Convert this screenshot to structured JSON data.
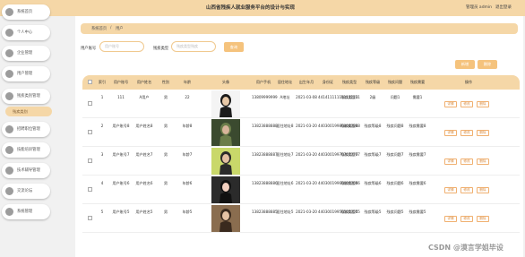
{
  "header": {
    "title": "山西省残疾人就业服务平台的设计与实现",
    "user": "管理员 admin",
    "exit": "退出登录"
  },
  "sidebar": {
    "items": [
      {
        "label": "系统首页"
      },
      {
        "label": "个人中心"
      },
      {
        "label": "企业管理"
      },
      {
        "label": "用户管理"
      },
      {
        "label": "残疾类别管理"
      },
      {
        "label": "招聘职位管理"
      },
      {
        "label": "技能培训管理"
      },
      {
        "label": "技术辅导管理"
      },
      {
        "label": "交流论坛"
      },
      {
        "label": "系统管理"
      }
    ],
    "sub_item": "残疾类别"
  },
  "breadcrumb": {
    "home": "系统首页",
    "sep": "/",
    "current": "用户"
  },
  "search": {
    "account_label": "用户账号",
    "account_placeholder": "用户账号",
    "type_label": "残疾类型",
    "type_placeholder": "残疾类型残疾",
    "button": "查询"
  },
  "actions": {
    "add": "新增",
    "delete": "删除"
  },
  "table": {
    "headers": [
      "索引",
      "用户账号",
      "用户姓名",
      "性别",
      "年龄",
      "头像",
      "用户手机",
      "居住地址",
      "出生年月",
      "身份证",
      "残疾类型",
      "残疾等级",
      "残疾问题",
      "残疾需要",
      "操作"
    ],
    "rows": [
      {
        "idx": "1",
        "account": "111",
        "name": "A用户",
        "sex": "男",
        "age": "22",
        "phone": "13809999999",
        "addr": "A地址",
        "birth": "2021-03-08",
        "idcard": "441411111111111111",
        "type": "残疾类型3",
        "level": "2级",
        "problem": "问题1",
        "need": "需要1"
      },
      {
        "idx": "2",
        "account": "用户账号8",
        "name": "用户姓名8",
        "sex": "男",
        "age": "年龄8",
        "phone": "13823888888",
        "addr": "居住地址8",
        "birth": "2021-03-20",
        "idcard": "440300199808080808",
        "type": "残疾类型8",
        "level": "残疾等级8",
        "problem": "残疾问题8",
        "need": "残疾需要8"
      },
      {
        "idx": "3",
        "account": "用户账号7",
        "name": "用户姓名7",
        "sex": "男",
        "age": "年龄7",
        "phone": "13823888887",
        "addr": "居住地址7",
        "birth": "2021-03-20",
        "idcard": "440300199707070707",
        "type": "残疾类型7",
        "level": "残疾等级7",
        "problem": "残疾问题7",
        "need": "残疾需要7"
      },
      {
        "idx": "4",
        "account": "用户账号6",
        "name": "用户姓名6",
        "sex": "男",
        "age": "年龄6",
        "phone": "13823888886",
        "addr": "居住地址6",
        "birth": "2021-03-20",
        "idcard": "440300199606060606",
        "type": "残疾类型6",
        "level": "残疾等级6",
        "problem": "残疾问题6",
        "need": "残疾需要6"
      },
      {
        "idx": "5",
        "account": "用户账号5",
        "name": "用户姓名5",
        "sex": "男",
        "age": "年龄5",
        "phone": "13823888885",
        "addr": "居住地址5",
        "birth": "2021-03-20",
        "idcard": "440300199505050505",
        "type": "残疾类型5",
        "level": "残疾等级5",
        "problem": "残疾问题5",
        "need": "残疾需要5"
      }
    ],
    "op_labels": [
      "详情",
      "修改",
      "删除"
    ]
  },
  "watermark": "CSDN @漠言学姐毕设",
  "colors": {
    "accent": "#f5d7a7",
    "button": "#f5c37d",
    "op_border": "#f0b070"
  }
}
